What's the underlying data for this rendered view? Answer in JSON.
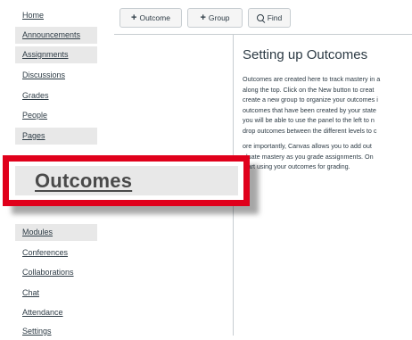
{
  "nav": {
    "items": [
      {
        "label": "Home"
      },
      {
        "label": "Announcements"
      },
      {
        "label": "Assignments"
      },
      {
        "label": "Discussions"
      },
      {
        "label": "Grades"
      },
      {
        "label": "People"
      },
      {
        "label": "Pages"
      },
      {
        "label": "Modules"
      },
      {
        "label": "Conferences"
      },
      {
        "label": "Collaborations"
      },
      {
        "label": "Chat"
      },
      {
        "label": "Attendance"
      },
      {
        "label": "Settings"
      }
    ]
  },
  "toolbar": {
    "outcome_label": "Outcome",
    "group_label": "Group",
    "find_label": "Find",
    "plus_icon": "+"
  },
  "main": {
    "title": "Setting up Outcomes",
    "para1_lines": [
      "Outcomes are created here to track mastery in a",
      "along the top. Click on the New button to creat",
      "create a new group to organize your outcomes i",
      "outcomes that have been created by your state",
      "you will be able to use the panel to the left to n",
      "drop outcomes between the different levels to c"
    ],
    "para2_lines": [
      "ore importantly, Canvas allows you to add out",
      "aluate mastery as you grade assignments. On",
      "start using your outcomes for grading."
    ]
  },
  "callout": {
    "label": "Outcomes",
    "border_color": "#e0001b"
  }
}
